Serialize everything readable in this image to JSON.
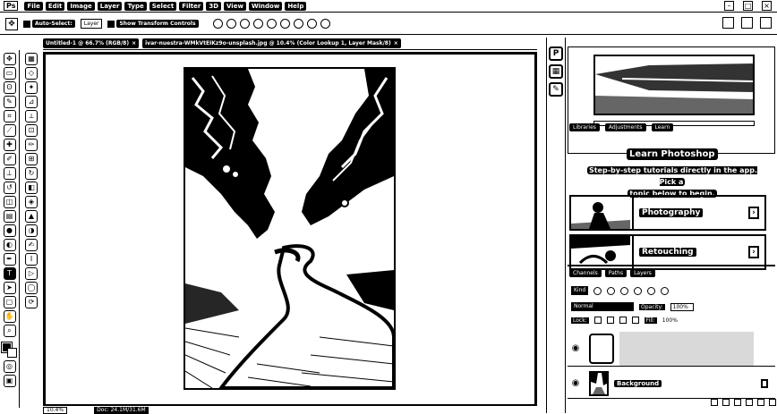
{
  "app": {
    "logo": "Ps",
    "menu": [
      "File",
      "Edit",
      "Image",
      "Layer",
      "Type",
      "Select",
      "Filter",
      "3D",
      "View",
      "Window",
      "Help"
    ]
  },
  "options": {
    "auto_select_label": "Auto-Select:",
    "auto_select_value": "Layer",
    "show_transform_label": "Show Transform Controls"
  },
  "document_tabs": [
    {
      "label": "Untitled-1 @ 66.7% (RGB/8)"
    },
    {
      "label": "ivar-nuestra-WMkVtEIKz9o-unsplash.jpg @ 10.4% (Color Lookup 1, Layer Mask/8)"
    }
  ],
  "status": {
    "zoom": "10.4%",
    "doc_info": "Doc: 24.1M/31.6M"
  },
  "right_strip": [
    "P",
    "▦",
    "✎"
  ],
  "learn": {
    "title": "Learn Photoshop",
    "description_line1": "Step-by-step tutorials directly in the app. Pick a",
    "description_line2": "topic below to begin.",
    "cards": [
      {
        "label": "Photography"
      },
      {
        "label": "Retouching"
      }
    ]
  },
  "panel_tabs": [
    "Libraries",
    "Adjustments",
    "Learn"
  ],
  "layers": {
    "tabs": [
      "Channels",
      "Paths",
      "Layers"
    ],
    "kind_label": "Kind",
    "blend_mode": "Normal",
    "opacity_label": "Opacity:",
    "opacity_value": "100%",
    "lock_label": "Lock:",
    "fill_label": "Fill:",
    "fill_value": "100%",
    "items": [
      {
        "name": ""
      },
      {
        "name": "Background"
      }
    ]
  }
}
